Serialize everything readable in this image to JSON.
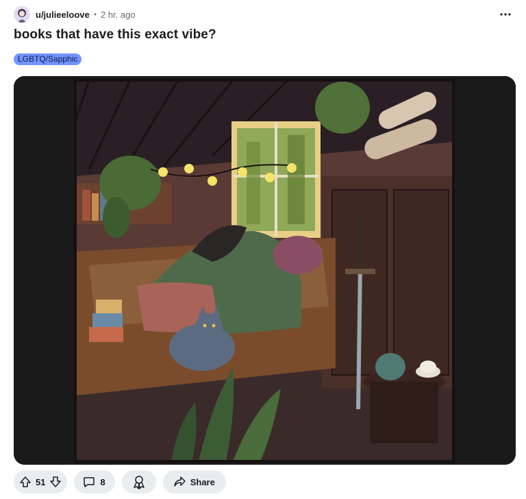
{
  "post": {
    "author": "u/julieeloove",
    "separator": "•",
    "time": "2 hr. ago",
    "title": "books that have this exact vibe?",
    "flair": {
      "label": "LGBTQ/Sapphic",
      "color": "#7193ff"
    }
  },
  "actions": {
    "upvotes": "51",
    "comments": "8",
    "share_label": "Share"
  },
  "icons": {
    "more": "more-horizontal-icon",
    "upvote": "upvote-arrow-icon",
    "downvote": "downvote-arrow-icon",
    "comment": "comment-bubble-icon",
    "award": "award-icon",
    "share": "share-arrow-icon"
  },
  "colors": {
    "flair_bg": "#7193ff",
    "pill_bg": "#eaedef",
    "media_bg": "#1e1e1e"
  }
}
